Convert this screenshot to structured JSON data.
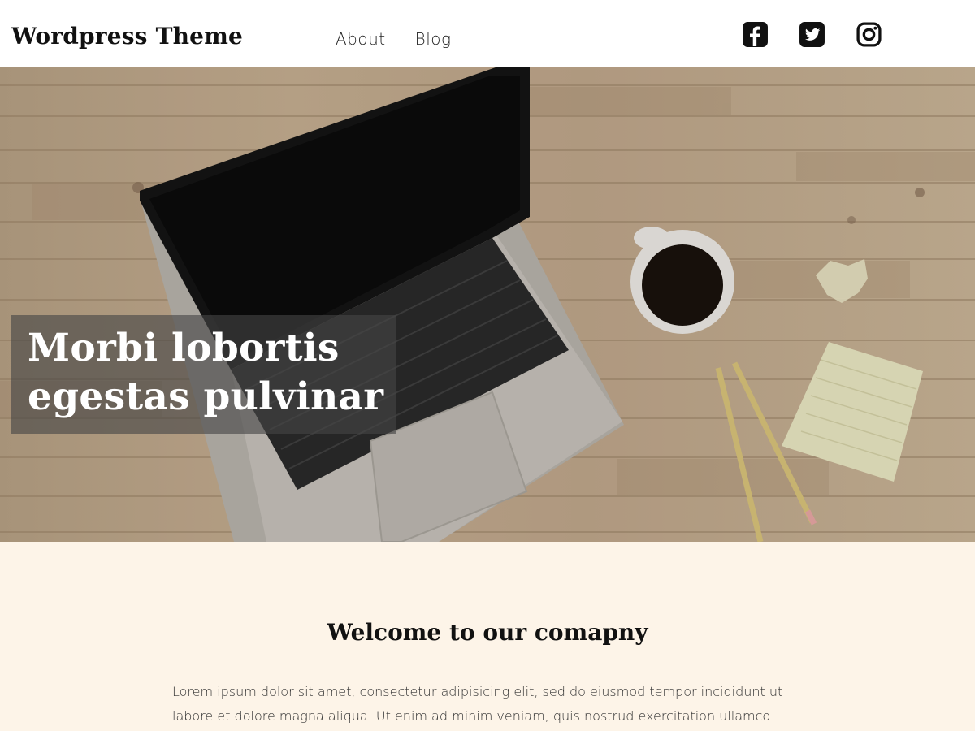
{
  "header": {
    "site_title": "Wordpress Theme",
    "nav": [
      {
        "label": "About"
      },
      {
        "label": "Blog"
      }
    ],
    "social": [
      {
        "icon": "facebook-icon"
      },
      {
        "icon": "twitter-icon"
      },
      {
        "icon": "instagram-icon"
      }
    ]
  },
  "hero": {
    "title": "Morbi lobortis egestas pulvinar",
    "image": "hero-desk-photo"
  },
  "main": {
    "welcome_title": "Welcome to our comapny",
    "welcome_text": "Lorem ipsum dolor sit amet, consectetur adipisicing elit, sed do eiusmod tempor incididunt ut labore et dolore magna aliqua. Ut enim ad minim veniam, quis nostrud exercitation ullamco"
  },
  "colors": {
    "header_bg": "#ffffff",
    "content_bg": "#fdf4e8",
    "hero_overlay": "#464646",
    "text_dark": "#111111"
  }
}
